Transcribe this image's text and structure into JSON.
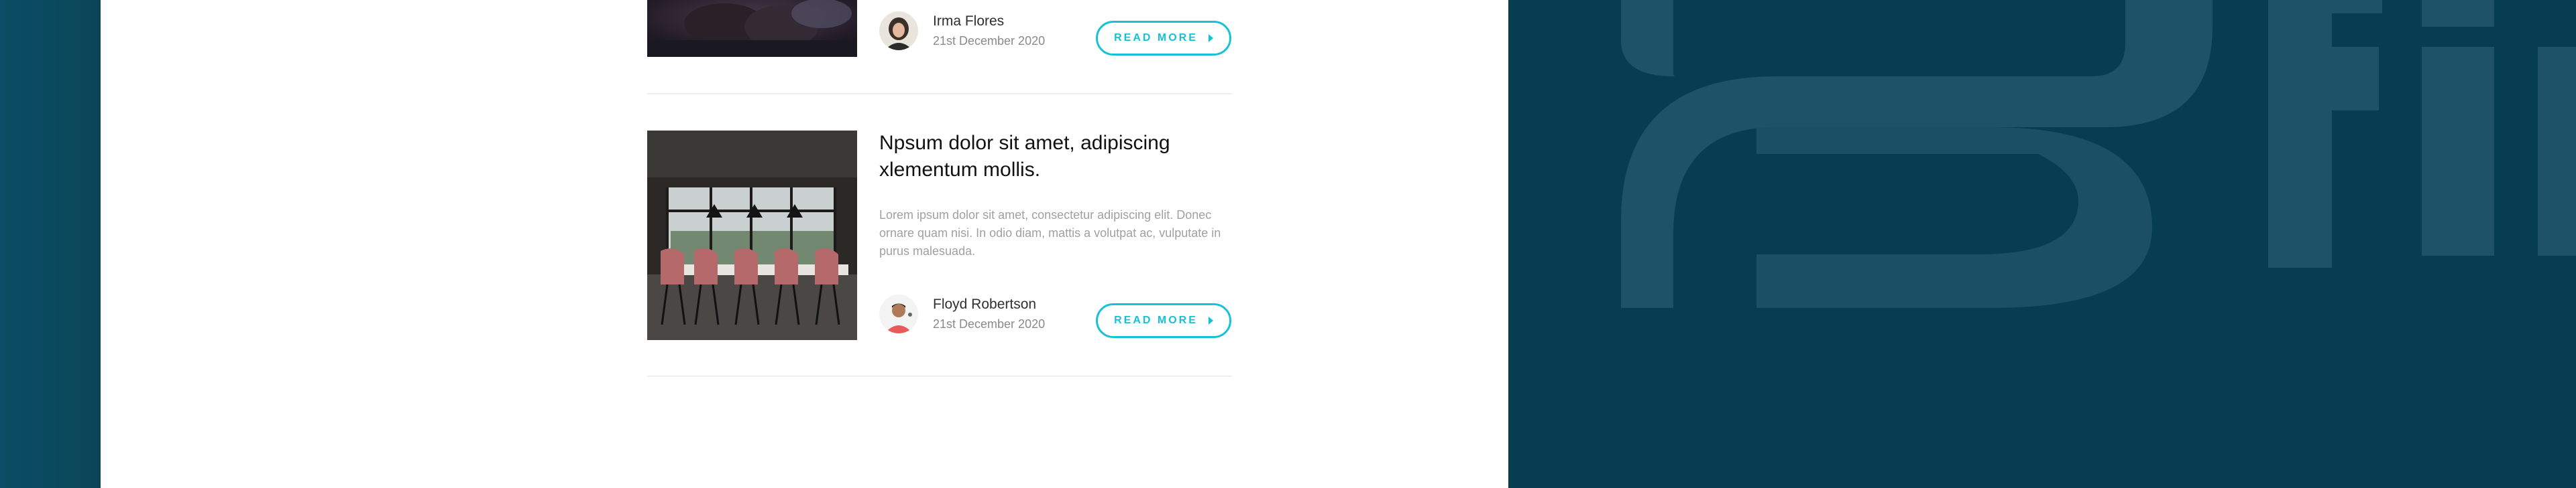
{
  "posts": [
    {
      "author": "Irma Flores",
      "date": "21st December 2020",
      "button_label": "READ MORE"
    },
    {
      "title": "Npsum dolor sit amet, adipiscing xlementum mollis.",
      "excerpt": "Lorem ipsum dolor sit amet, consectetur adipiscing elit. Donec ornare quam nisi. In odio diam, mattis a volutpat ac, vulputate in purus malesuada.",
      "author": "Floyd Robertson",
      "date": "21st December 2020",
      "button_label": "READ MORE"
    }
  ],
  "colors": {
    "accent": "#16c2d5",
    "background_dark": "#073d51",
    "panel": "#ffffff"
  }
}
